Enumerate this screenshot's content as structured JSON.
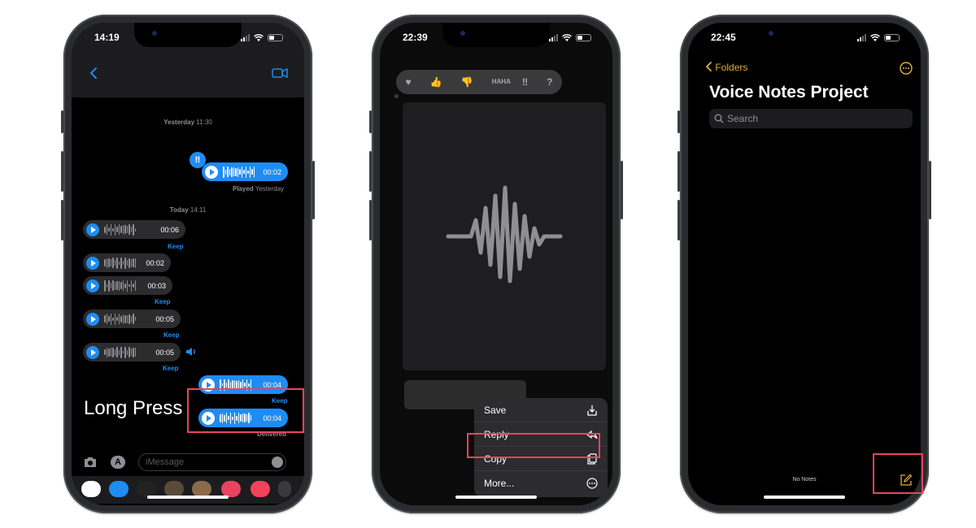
{
  "phone1": {
    "time": "14:19",
    "timestamp_yesterday_day": "Yesterday",
    "timestamp_yesterday_time": "11:30",
    "timestamp_today_day": "Today",
    "timestamp_today_time": "14:11",
    "messages": [
      {
        "dir": "out",
        "duration": "00:02"
      },
      {
        "dir": "in",
        "duration": "00:06"
      },
      {
        "dir": "in",
        "duration": "00:02"
      },
      {
        "dir": "in",
        "duration": "00:03"
      },
      {
        "dir": "in",
        "duration": "00:05"
      },
      {
        "dir": "in",
        "duration": "00:05"
      },
      {
        "dir": "out",
        "duration": "00:04"
      },
      {
        "dir": "out",
        "duration": "00:04"
      }
    ],
    "played_label": "Played",
    "played_when": "Yesterday",
    "keep_label": "Keep",
    "delivered_label": "Delivered",
    "input_placeholder": "iMessage",
    "overlay_label": "Long Press"
  },
  "phone2": {
    "time": "22:39",
    "tapbacks": [
      "♥",
      "👍",
      "👎",
      "HAHA",
      "‼",
      "?"
    ],
    "menu": [
      {
        "label": "Save",
        "icon": "save-icon"
      },
      {
        "label": "Reply",
        "icon": "reply-icon"
      },
      {
        "label": "Copy",
        "icon": "copy-icon"
      },
      {
        "label": "More...",
        "icon": "more-icon"
      }
    ]
  },
  "phone3": {
    "time": "22:45",
    "back_label": "Folders",
    "title": "Voice Notes Project",
    "search_placeholder": "Search",
    "empty_label": "No Notes"
  },
  "colors": {
    "accent_blue": "#1f8cf4",
    "highlight": "#e8445f",
    "notes_yellow": "#e3b134"
  }
}
